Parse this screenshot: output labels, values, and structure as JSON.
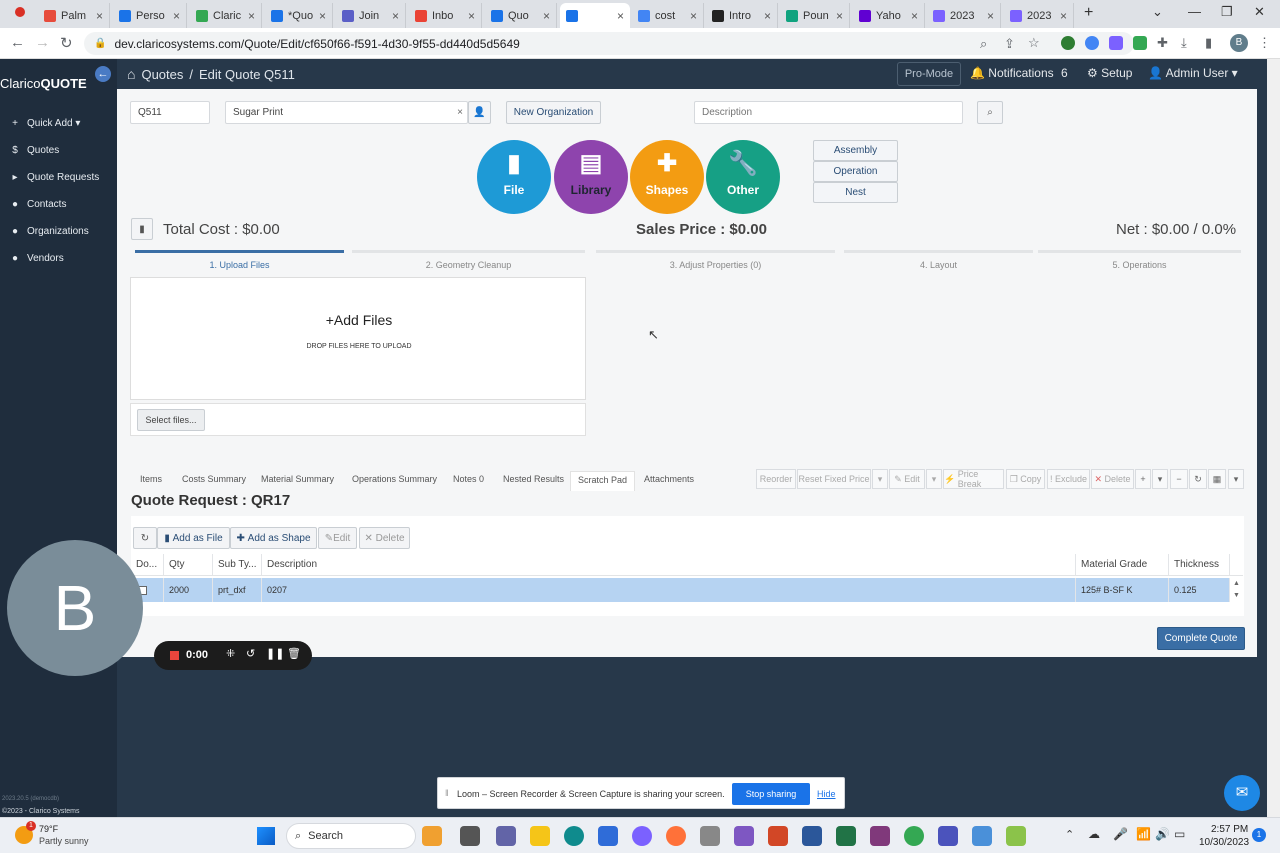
{
  "browser": {
    "tabs": [
      {
        "label": "Palm",
        "color": "#e74c3c"
      },
      {
        "label": "Perso",
        "color": "#1a73e8"
      },
      {
        "label": "Claric",
        "color": "#34a853"
      },
      {
        "label": "*Quo",
        "color": "#1a73e8"
      },
      {
        "label": "Join",
        "color": "#5b5fc7"
      },
      {
        "label": "Inbo",
        "color": "#ea4335"
      },
      {
        "label": "Quo",
        "color": "#1a73e8"
      },
      {
        "label": "",
        "color": "#1a73e8"
      },
      {
        "label": "cost",
        "color": "#4285f4"
      },
      {
        "label": "Intro",
        "color": "#222222"
      },
      {
        "label": "Poun",
        "color": "#10a37f"
      },
      {
        "label": "Yaho",
        "color": "#6001d2"
      },
      {
        "label": "2023",
        "color": "#7b61ff"
      },
      {
        "label": "2023",
        "color": "#7b61ff"
      }
    ],
    "url": "dev.claricosystems.com/Quote/Edit/cf650f66-f591-4d30-9f55-dd440d5d5649"
  },
  "app": {
    "brand_prefix": "Clarico",
    "brand_bold": "QUOTE",
    "version": "2023.20.5 (democdb)",
    "copyright": "©2023 - Clarico Systems",
    "sidebar": [
      {
        "label": "Quick Add ▾",
        "icon": "plus-icon"
      },
      {
        "label": "Quotes",
        "icon": "dollar-icon"
      },
      {
        "label": "Quote Requests",
        "icon": "request-icon"
      },
      {
        "label": "Contacts",
        "icon": "user-icon"
      },
      {
        "label": "Organizations",
        "icon": "users-icon"
      },
      {
        "label": "Vendors",
        "icon": "users-icon"
      }
    ],
    "breadcrumb": {
      "root": "Quotes",
      "sep": "/",
      "current": "Edit Quote Q511"
    },
    "header": {
      "pro_mode": "Pro-Mode",
      "notifications_label": "Notifications",
      "notifications_count": "6",
      "setup": "Setup",
      "user": "Admin User ▾"
    }
  },
  "quote": {
    "number": "Q511",
    "organization": "Sugar Print",
    "new_org_button": "New Organization",
    "description_placeholder": "Description",
    "tools": [
      {
        "label": "File",
        "color": "#1e9ad6",
        "icon": "file-icon"
      },
      {
        "label": "Library",
        "color": "#8e44ad",
        "icon": "book-icon"
      },
      {
        "label": "Shapes",
        "color": "#f39c12",
        "icon": "puzzle-icon"
      },
      {
        "label": "Other",
        "color": "#16a085",
        "icon": "wrench-icon"
      }
    ],
    "side_buttons": [
      "Assembly",
      "Operation",
      "Nest"
    ],
    "total_cost": "Total Cost : $0.00",
    "sales_price": "Sales Price : $0.00",
    "net": "Net : $0.00 / 0.0%",
    "steps": [
      "1. Upload Files",
      "2. Geometry Cleanup",
      "3. Adjust Properties (0)",
      "4. Layout",
      "5. Operations"
    ],
    "upload": {
      "title": "+Add Files",
      "subtitle": "DROP FILES HERE TO UPLOAD",
      "select_button": "Select files..."
    },
    "bottom_tabs": [
      "Items",
      "Costs Summary",
      "Material Summary",
      "Operations Summary",
      "Notes 0",
      "Nested Results",
      "Scratch Pad",
      "Attachments"
    ],
    "toolbar": [
      "Reorder",
      "Reset Fixed Price",
      "Edit",
      "Price Break",
      "Copy",
      "Exclude",
      "Delete"
    ],
    "request_title": "Quote Request : QR17",
    "request_actions": [
      "Add as File",
      "Add as Shape",
      "Edit",
      "Delete"
    ],
    "table": {
      "headers": [
        "Do...",
        "Qty",
        "Sub Ty...",
        "Description",
        "Material Grade",
        "Thickness"
      ],
      "rows": [
        {
          "qty": "2000",
          "subtype": "prt_dxf",
          "description": "0207",
          "grade": "125# B-SF K",
          "thickness": "0.125"
        }
      ]
    },
    "complete_button": "Complete Quote"
  },
  "overlays": {
    "avatar_letter": "B",
    "recorder_time": "0:00",
    "share_text": "Loom – Screen Recorder & Screen Capture is sharing your screen.",
    "stop_sharing": "Stop sharing",
    "hide": "Hide"
  },
  "taskbar": {
    "weather_temp": "79°F",
    "weather_desc": "Partly sunny",
    "weather_badge": "1",
    "search": "Search",
    "time": "2:57 PM",
    "date": "10/30/2023",
    "notif_count": "1"
  }
}
